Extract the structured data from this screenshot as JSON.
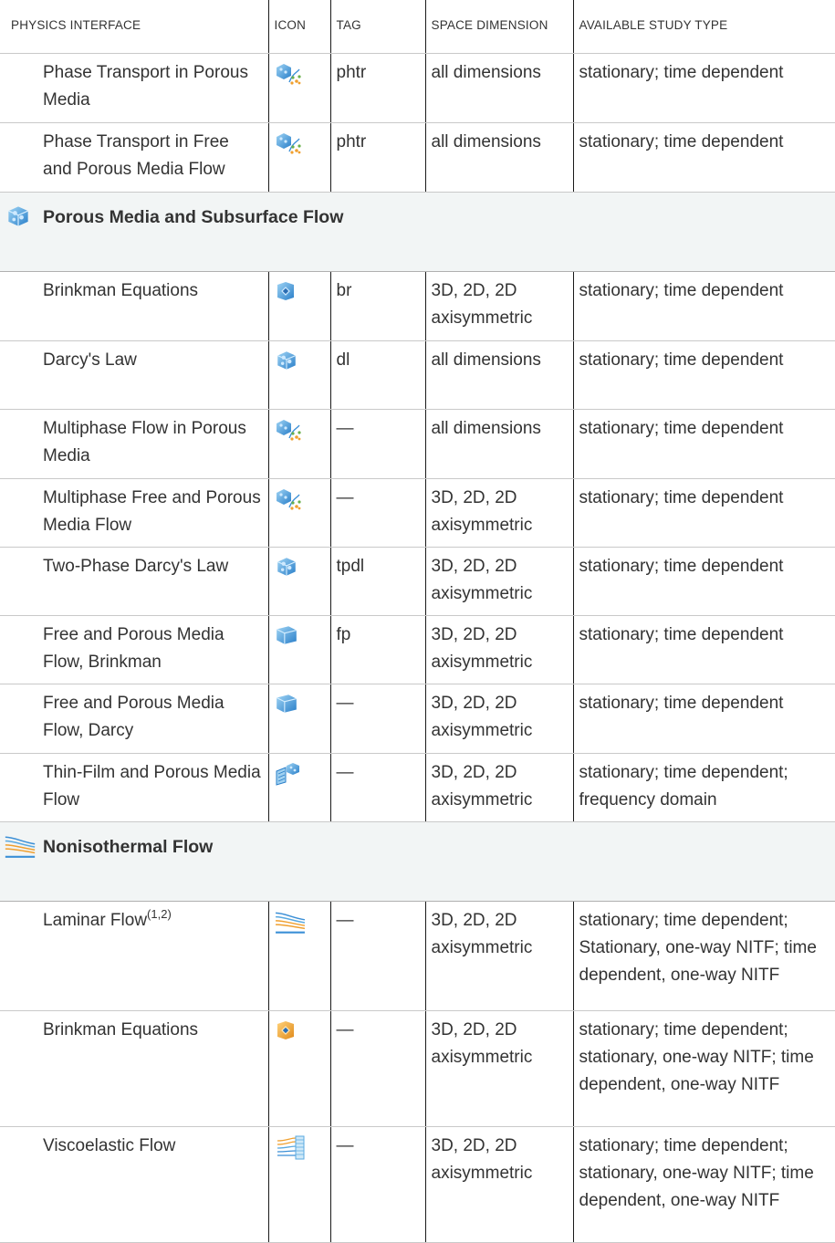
{
  "header": {
    "col_interface": "PHYSICS INTERFACE",
    "col_icon": "ICON",
    "col_tag": "TAG",
    "col_dimension": "SPACE DIMENSION",
    "col_study": "AVAILABLE STUDY TYPE"
  },
  "rows_top": [
    {
      "name": "Phase Transport in Porous Media",
      "icon": "phase-transport-porous-icon",
      "tag": "phtr",
      "dimension": "all dimensions",
      "study": "stationary; time dependent"
    },
    {
      "name": "Phase Transport in Free and Porous Media Flow",
      "icon": "phase-transport-free-porous-icon",
      "tag": "phtr",
      "dimension": "all dimensions",
      "study": "stationary; time dependent"
    }
  ],
  "section_porous": {
    "title": "Porous Media and Subsurface Flow",
    "icon": "porous-media-icon"
  },
  "rows_porous": [
    {
      "name": "Brinkman Equations",
      "icon": "brinkman-icon",
      "tag": "br",
      "dimension": "3D, 2D, 2D axisymmetric",
      "study": "stationary; time dependent"
    },
    {
      "name": "Darcy's Law",
      "icon": "darcy-icon",
      "tag": "dl",
      "dimension": "all dimensions",
      "study": "stationary; time dependent"
    },
    {
      "name": "Multiphase Flow in Porous Media",
      "icon": "multiphase-porous-icon",
      "tag": "—",
      "dimension": "all dimensions",
      "study": "stationary; time dependent"
    },
    {
      "name": "Multiphase Free and Porous Media Flow",
      "icon": "multiphase-free-porous-icon",
      "tag": "—",
      "dimension": "3D, 2D, 2D axisymmetric",
      "study": "stationary; time dependent"
    },
    {
      "name": "Two-Phase Darcy's Law",
      "icon": "two-phase-darcy-icon",
      "tag": "tpdl",
      "dimension": "3D, 2D, 2D axisymmetric",
      "study": "stationary; time dependent"
    },
    {
      "name": "Free and Porous Media Flow, Brinkman",
      "icon": "free-porous-brinkman-icon",
      "tag": "fp",
      "dimension": "3D, 2D, 2D axisymmetric",
      "study": "stationary; time dependent"
    },
    {
      "name": "Free and Porous Media Flow, Darcy",
      "icon": "free-porous-darcy-icon",
      "tag": "—",
      "dimension": "3D, 2D, 2D axisymmetric",
      "study": "stationary; time dependent"
    },
    {
      "name": "Thin-Film and Porous Media Flow",
      "icon": "thin-film-porous-icon",
      "tag": "—",
      "dimension": "3D, 2D, 2D axisymmetric",
      "study": "stationary; time dependent; frequency domain"
    }
  ],
  "section_nonisothermal": {
    "title": "Nonisothermal Flow",
    "icon": "nonisothermal-flow-icon"
  },
  "rows_nonisothermal": [
    {
      "name": "Laminar Flow",
      "superscript": "(1,2)",
      "icon": "laminar-flow-icon",
      "tag": "—",
      "dimension": "3D, 2D, 2D axisymmetric",
      "study": "stationary; time dependent; Stationary, one-way NITF; time dependent, one-way NITF"
    },
    {
      "name": "Brinkman Equations",
      "icon": "brinkman-heat-icon",
      "tag": "—",
      "dimension": "3D, 2D, 2D axisymmetric",
      "study": "stationary; time dependent; stationary, one-way NITF; time dependent, one-way NITF"
    },
    {
      "name": "Viscoelastic Flow",
      "icon": "viscoelastic-flow-icon",
      "tag": "—",
      "dimension": "3D, 2D, 2D axisymmetric",
      "study": "stationary; time dependent; stationary, one-way NITF; time dependent, one-way NITF"
    }
  ],
  "colors": {
    "icon_blue": "#3d8fd1",
    "icon_light_blue": "#8cc8f0",
    "icon_orange": "#f0a030",
    "icon_green": "#6ab04c",
    "section_bg": "#f2f5f5",
    "rule": "#1a1a1a"
  }
}
